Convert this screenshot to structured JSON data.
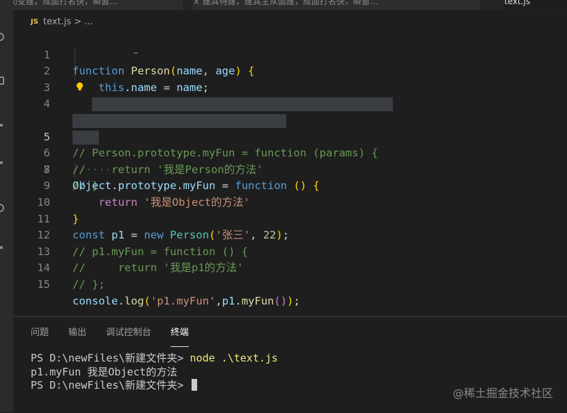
{
  "tabs": [
    {
      "label": "功变建，成面打名快，瞬窗…"
    },
    {
      "label": "× 建其待建，建其主从面建，成面打名快，瞬窗…"
    },
    {
      "label": "text.js"
    }
  ],
  "breadcrumb": {
    "lang_badge": "JS",
    "file": "text.js",
    "separator": ">",
    "trail": "..."
  },
  "code_lines": [
    {
      "n": "1"
    },
    {
      "n": "2"
    },
    {
      "n": "3"
    },
    {
      "n": "4"
    },
    {
      "n": "5"
    },
    {
      "n": "6"
    },
    {
      "n": "7"
    },
    {
      "n": "8"
    },
    {
      "n": "9"
    },
    {
      "n": "10"
    },
    {
      "n": "11"
    },
    {
      "n": "12"
    },
    {
      "n": "13"
    },
    {
      "n": "14"
    },
    {
      "n": "15"
    }
  ],
  "tokens": {
    "function": "function",
    "Person": "Person",
    "name": "name",
    "age": "age",
    "this": "this",
    "comment5": "// Person.prototype.myFun = function (params) {",
    "comment6a": "//",
    "comment6dots": "····",
    "comment6b": "return '我是Person的方法'",
    "comment7": "// }",
    "Object": "Object",
    "prototype": "prototype",
    "myFun": "myFun",
    "return": "return",
    "str9": "'我是Object的方法'",
    "const": "const",
    "p1": "p1",
    "new": "new",
    "str11": "'张三'",
    "num11": "22",
    "comment12": "// p1.myFun = function () {",
    "comment13": "//     return '我是p1的方法'",
    "comment14": "// };",
    "console": "console",
    "log": "log",
    "str15": "'p1.myFun'"
  },
  "panel": {
    "tabs": [
      {
        "label": "问题",
        "active": false
      },
      {
        "label": "输出",
        "active": false
      },
      {
        "label": "调试控制台",
        "active": false
      },
      {
        "label": "终端",
        "active": true
      }
    ],
    "terminal": {
      "prompt1": "PS D:\\newFiles\\新建文件夹>",
      "command": "node .\\text.js",
      "output": "p1.myFun 我是Object的方法",
      "prompt2": "PS D:\\newFiles\\新建文件夹>"
    }
  },
  "watermark": "@稀土掘金技术社区"
}
